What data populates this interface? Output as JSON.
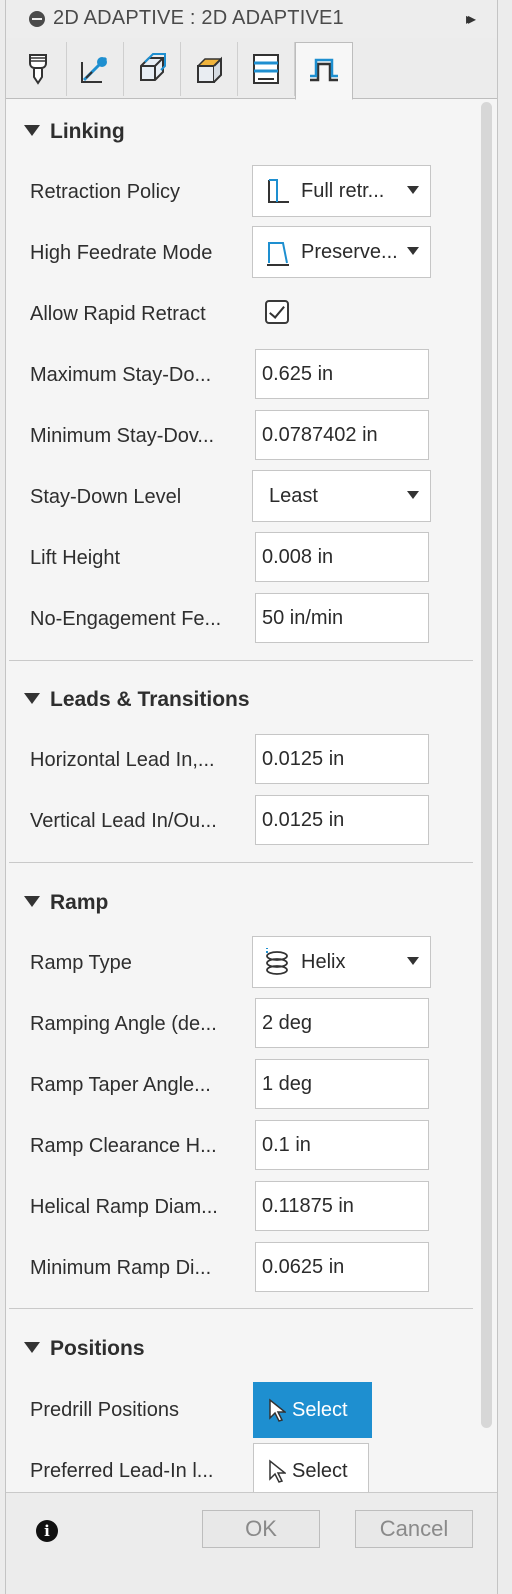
{
  "window": {
    "title": "2D ADAPTIVE : 2D ADAPTIVE1",
    "expand_glyph": "▸▸"
  },
  "tabs": [
    {
      "name": "tool-tab",
      "icon": "tool-icon"
    },
    {
      "name": "geometry-tab",
      "icon": "geometry-icon"
    },
    {
      "name": "heights-tab",
      "icon": "heights-icon"
    },
    {
      "name": "passes-tab",
      "icon": "passes-icon"
    },
    {
      "name": "linking-params-tab",
      "icon": "multiple-depths-icon"
    },
    {
      "name": "linking-tab",
      "icon": "linking-icon",
      "active": true
    }
  ],
  "sections": {
    "linking": {
      "title": "Linking",
      "retraction_policy": {
        "label": "Retraction Policy",
        "value": "Full retr..."
      },
      "high_feedrate_mode": {
        "label": "High Feedrate Mode",
        "value": "Preserve..."
      },
      "allow_rapid_retract": {
        "label": "Allow Rapid Retract",
        "checked": true
      },
      "maximum_stay_down": {
        "label": "Maximum Stay-Do...",
        "value": "0.625 in"
      },
      "minimum_stay_down": {
        "label": "Minimum Stay-Dov...",
        "value": "0.0787402 in"
      },
      "stay_down_level": {
        "label": "Stay-Down Level",
        "value": "Least"
      },
      "lift_height": {
        "label": "Lift Height",
        "value": "0.008 in"
      },
      "no_engagement_feedrate": {
        "label": "No-Engagement Fe...",
        "value": "50 in/min"
      }
    },
    "leads": {
      "title": "Leads & Transitions",
      "horizontal_lead": {
        "label": "Horizontal Lead In,...",
        "value": "0.0125 in"
      },
      "vertical_lead": {
        "label": "Vertical Lead In/Ou...",
        "value": "0.0125 in"
      }
    },
    "ramp": {
      "title": "Ramp",
      "ramp_type": {
        "label": "Ramp Type",
        "value": "Helix"
      },
      "ramping_angle": {
        "label": "Ramping Angle (de...",
        "value": "2 deg"
      },
      "ramp_taper_angle": {
        "label": "Ramp Taper Angle...",
        "value": "1 deg"
      },
      "ramp_clearance_height": {
        "label": "Ramp Clearance H...",
        "value": "0.1 in"
      },
      "helical_ramp_diameter": {
        "label": "Helical Ramp Diam...",
        "value": "0.11875 in"
      },
      "minimum_ramp_diameter": {
        "label": "Minimum Ramp Di...",
        "value": "0.0625 in"
      }
    },
    "positions": {
      "title": "Positions",
      "predrill_positions": {
        "label": "Predrill Positions",
        "button": "Select"
      },
      "preferred_lead_in": {
        "label": "Preferred Lead-In l...",
        "button": "Select"
      }
    }
  },
  "footer": {
    "ok": "OK",
    "cancel": "Cancel",
    "info_glyph": "i"
  },
  "colors": {
    "accent": "#1e8fd0",
    "panel": "#f5f5f5"
  }
}
